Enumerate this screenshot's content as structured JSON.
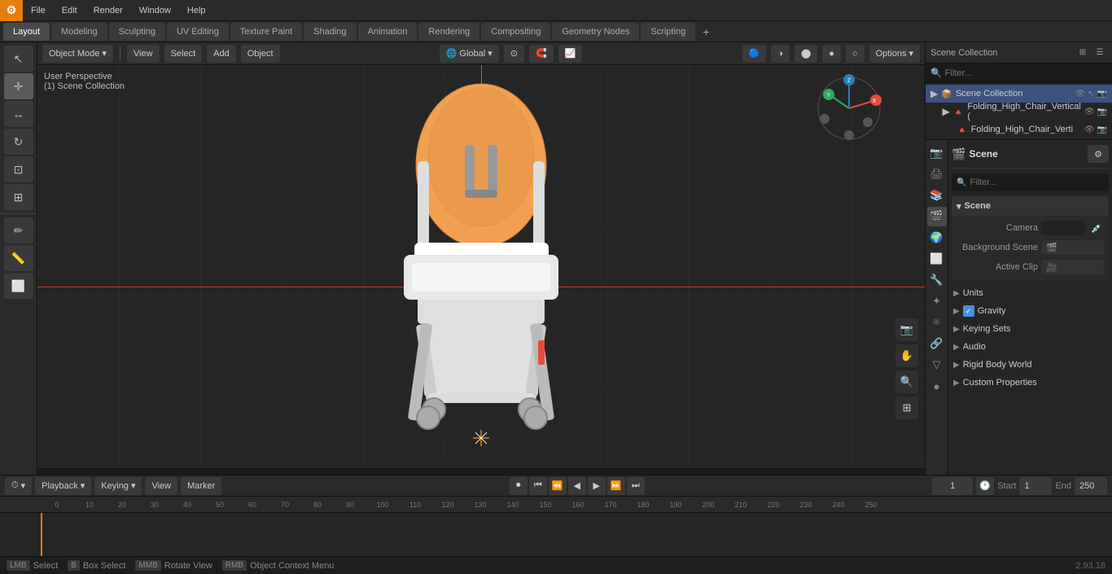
{
  "app": {
    "title": "Blender",
    "version": "2.93.18"
  },
  "menu": {
    "items": [
      "File",
      "Edit",
      "Render",
      "Window",
      "Help"
    ]
  },
  "workspace_tabs": {
    "tabs": [
      "Layout",
      "Modeling",
      "Sculpting",
      "UV Editing",
      "Texture Paint",
      "Shading",
      "Animation",
      "Rendering",
      "Compositing",
      "Geometry Nodes",
      "Scripting"
    ],
    "active": "Layout"
  },
  "viewport_header": {
    "mode": "Object Mode",
    "view_label": "View",
    "select_label": "Select",
    "add_label": "Add",
    "object_label": "Object",
    "transform_global": "Global",
    "options_label": "Options"
  },
  "viewport_info": {
    "line1": "User Perspective",
    "line2": "(1) Scene Collection"
  },
  "outliner": {
    "title": "Scene Collection",
    "search_placeholder": "Filter...",
    "items": [
      {
        "label": "Folding_High_Chair_Vertical (",
        "indent": 0,
        "icon": "📦",
        "selected": true
      },
      {
        "label": "Folding_High_Chair_Verti",
        "indent": 1,
        "icon": "🔺",
        "selected": false
      }
    ]
  },
  "properties": {
    "active_tab": "scene",
    "scene_name": "Scene",
    "sections": {
      "scene": {
        "title": "Scene",
        "camera_label": "Camera",
        "camera_value": "",
        "background_scene_label": "Background Scene",
        "active_clip_label": "Active Clip"
      },
      "units": {
        "title": "Units"
      },
      "gravity": {
        "title": "Gravity",
        "enabled": true
      },
      "keying_sets": {
        "title": "Keying Sets"
      },
      "audio": {
        "title": "Audio"
      },
      "rigid_body_world": {
        "title": "Rigid Body World"
      },
      "custom_properties": {
        "title": "Custom Properties"
      }
    }
  },
  "timeline": {
    "playback_label": "Playback",
    "keying_label": "Keying",
    "view_label": "View",
    "marker_label": "Marker",
    "current_frame": "1",
    "start_label": "Start",
    "start_frame": "1",
    "end_label": "End",
    "end_frame": "250",
    "ruler_marks": [
      "0",
      "10",
      "20",
      "30",
      "40",
      "50",
      "60",
      "70",
      "80",
      "90",
      "100",
      "110",
      "120",
      "130",
      "140",
      "150",
      "160",
      "170",
      "180",
      "190",
      "200",
      "210",
      "220",
      "230",
      "240",
      "250"
    ]
  },
  "status_bar": {
    "select_label": "Select",
    "box_select_label": "Box Select",
    "rotate_view_label": "Rotate View",
    "object_context_label": "Object Context Menu",
    "version": "2.93.18"
  },
  "collection_label": "Collection"
}
